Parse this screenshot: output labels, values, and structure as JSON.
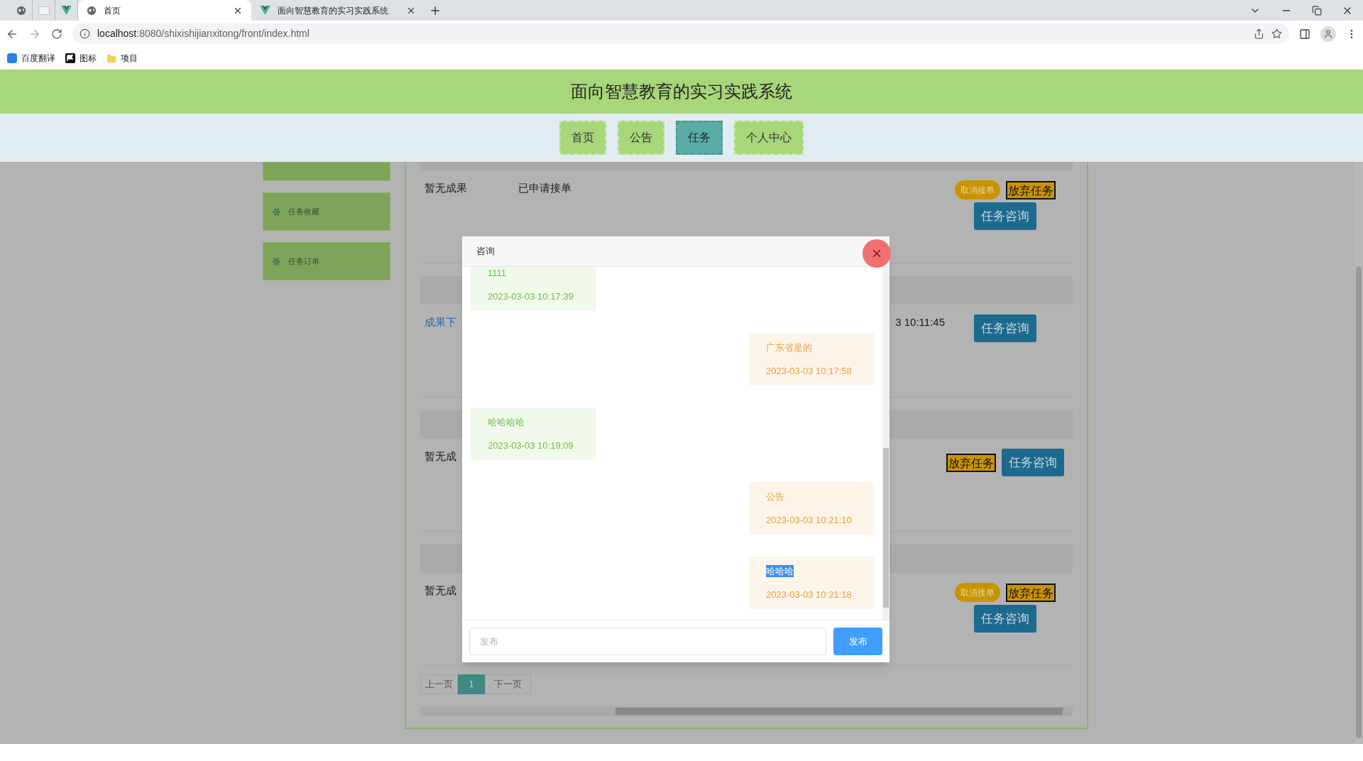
{
  "browser": {
    "tabs": [
      {
        "kind": "globe",
        "selected": false
      },
      {
        "kind": "blank",
        "selected": false
      },
      {
        "kind": "vue",
        "selected": false
      },
      {
        "kind": "globe",
        "label": "首页",
        "selected": true
      },
      {
        "kind": "vue",
        "label": "面向智慧教育的实习实践系统",
        "selected": false
      }
    ],
    "url_host": "localhost",
    "url_rest": ":8080/shixishijianxitong/front/index.html",
    "bookmarks": [
      {
        "kind": "translate",
        "label": "百度翻译"
      },
      {
        "kind": "flag",
        "label": "图标"
      },
      {
        "kind": "folder",
        "label": "项目"
      }
    ]
  },
  "site_title": "面向智慧教育的实习实践系统",
  "nav": [
    {
      "label": "首页",
      "selected": false
    },
    {
      "label": "公告",
      "selected": false
    },
    {
      "label": "任务",
      "selected": true
    },
    {
      "label": "个人中心",
      "selected": false
    }
  ],
  "sidebar": [
    {
      "label": "任务收藏"
    },
    {
      "label": "任务订单"
    }
  ],
  "rows": [
    {
      "cells": [
        {
          "text": "暂无成果",
          "kind": "text"
        },
        {
          "text": "已申请接单",
          "kind": "text"
        }
      ],
      "actions": [
        {
          "kind": "pill",
          "label": "取消接单"
        },
        {
          "kind": "outlined",
          "label": "放弃任务"
        },
        {
          "kind": "primary",
          "label": "任务咨询"
        }
      ]
    },
    {
      "cells": [
        {
          "text": "成果下",
          "kind": "link"
        }
      ],
      "time": "3 10:11:45",
      "actions": [
        {
          "kind": "primary",
          "label": "任务咨询"
        }
      ]
    },
    {
      "cells": [
        {
          "text": "暂无成",
          "kind": "text"
        }
      ],
      "actions": [
        {
          "kind": "outlined",
          "label": "放弃任务"
        },
        {
          "kind": "primary",
          "label": "任务咨询"
        }
      ]
    },
    {
      "cells": [
        {
          "text": "暂无成",
          "kind": "text"
        }
      ],
      "actions": [
        {
          "kind": "pill",
          "label": "取消接单"
        },
        {
          "kind": "outlined",
          "label": "放弃任务"
        },
        {
          "kind": "primary",
          "label": "任务咨询"
        }
      ]
    }
  ],
  "pagination": {
    "prev": "上一页",
    "pages": [
      {
        "label": "1",
        "selected": true
      }
    ],
    "next": "下一页"
  },
  "dialog": {
    "title": "咨询",
    "messages": [
      {
        "kind": "received",
        "text": "1111",
        "time": "2023-03-03 10:17:39",
        "highlighted": false
      },
      {
        "kind": "sent",
        "text": "广东省是的",
        "time": "2023-03-03 10:17:58",
        "highlighted": false
      },
      {
        "kind": "received",
        "text": "哈哈哈哈",
        "time": "2023-03-03 10:19:09",
        "highlighted": false
      },
      {
        "kind": "sent",
        "text": "公告",
        "time": "2023-03-03 10:21:10",
        "highlighted": false
      },
      {
        "kind": "sent",
        "text": "哈哈哈",
        "time": "2023-03-03 10:21:18",
        "highlighted": true
      }
    ],
    "input_placeholder": "发布",
    "send_label": "发布"
  }
}
